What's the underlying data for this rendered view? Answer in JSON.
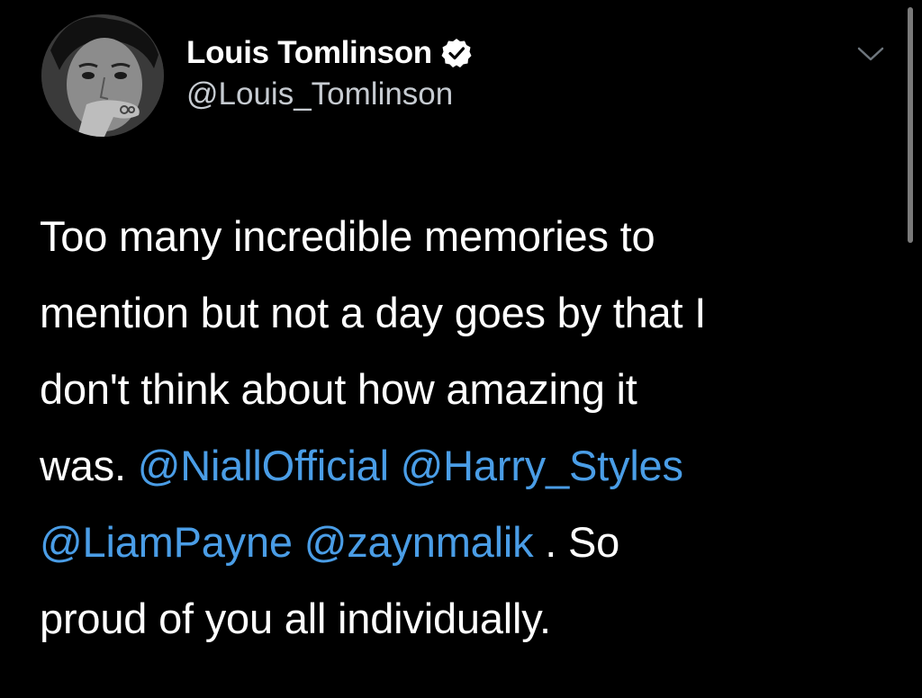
{
  "author": {
    "display_name": "Louis Tomlinson",
    "handle": "@Louis_Tomlinson",
    "verified": true,
    "avatar_icon": "profile-photo"
  },
  "tweet": {
    "line1": "Too many incredible memories to",
    "line2": "mention but not a day goes by that I",
    "line3": "don't think about how amazing it",
    "line4_prefix": "was. ",
    "mentions": [
      "@NiallOfficial",
      "@Harry_Styles",
      "@LiamPayne",
      "@zaynmalik"
    ],
    "line5_suffix": " . So",
    "line6": "proud of you all individually."
  },
  "colors": {
    "background": "#000000",
    "text": "#ffffff",
    "secondary_text": "#c6cbd1",
    "mention": "#4a9de6"
  },
  "icons": {
    "verified": "verified-badge-icon",
    "more": "chevron-down-icon"
  }
}
